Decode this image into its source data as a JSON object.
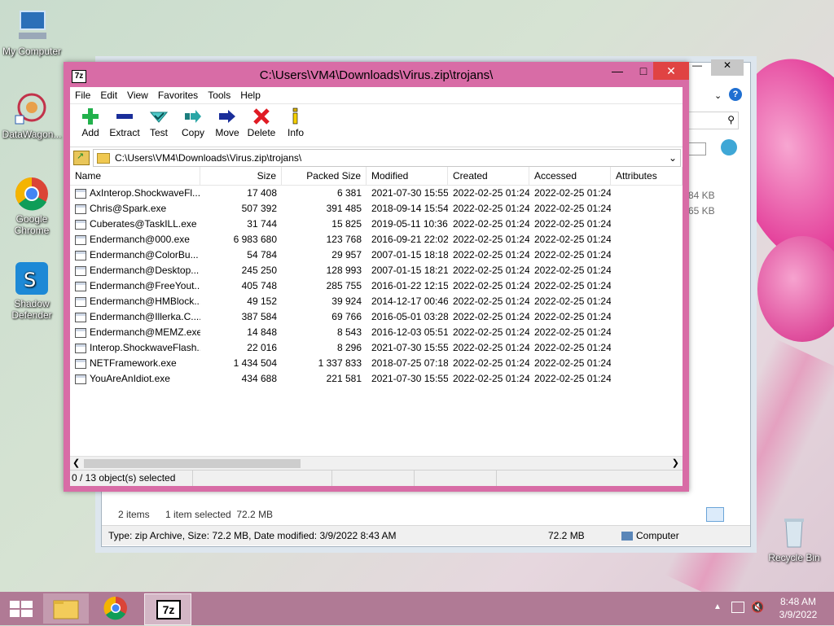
{
  "desktop": {
    "icons": [
      {
        "label": "My Computer"
      },
      {
        "label": "DataWagon..."
      },
      {
        "label": "Google Chrome"
      },
      {
        "label": "Shadow Defender"
      },
      {
        "label": "Recycle Bin"
      }
    ]
  },
  "explorer": {
    "size_col_values": [
      "84 KB",
      "65 KB"
    ],
    "items_count": "2 items",
    "selected": "1 item selected  72.2 MB",
    "status_type": "Type: zip Archive, Size: 72.2 MB, Date modified: 3/9/2022 8:43 AM",
    "status_size": "72.2 MB",
    "status_location": "Computer"
  },
  "window": {
    "title": "C:\\Users\\VM4\\Downloads\\Virus.zip\\trojans\\",
    "app_icon_label": "7z",
    "menu": [
      "File",
      "Edit",
      "View",
      "Favorites",
      "Tools",
      "Help"
    ],
    "toolbar": [
      "Add",
      "Extract",
      "Test",
      "Copy",
      "Move",
      "Delete",
      "Info"
    ],
    "address": "C:\\Users\\VM4\\Downloads\\Virus.zip\\trojans\\",
    "columns": [
      "Name",
      "Size",
      "Packed Size",
      "Modified",
      "Created",
      "Accessed",
      "Attributes"
    ],
    "files": [
      {
        "name": "AxInterop.ShockwaveFl...",
        "size": "17 408",
        "packed": "6 381",
        "modified": "2021-07-30 15:55",
        "created": "2022-02-25 01:24",
        "accessed": "2022-02-25 01:24"
      },
      {
        "name": "Chris@Spark.exe",
        "size": "507 392",
        "packed": "391 485",
        "modified": "2018-09-14 15:54",
        "created": "2022-02-25 01:24",
        "accessed": "2022-02-25 01:24"
      },
      {
        "name": "Cuberates@TaskILL.exe",
        "size": "31 744",
        "packed": "15 825",
        "modified": "2019-05-11 10:36",
        "created": "2022-02-25 01:24",
        "accessed": "2022-02-25 01:24"
      },
      {
        "name": "Endermanch@000.exe",
        "size": "6 983 680",
        "packed": "123 768",
        "modified": "2016-09-21 22:02",
        "created": "2022-02-25 01:24",
        "accessed": "2022-02-25 01:24"
      },
      {
        "name": "Endermanch@ColorBu...",
        "size": "54 784",
        "packed": "29 957",
        "modified": "2007-01-15 18:18",
        "created": "2022-02-25 01:24",
        "accessed": "2022-02-25 01:24"
      },
      {
        "name": "Endermanch@Desktop...",
        "size": "245 250",
        "packed": "128 993",
        "modified": "2007-01-15 18:21",
        "created": "2022-02-25 01:24",
        "accessed": "2022-02-25 01:24"
      },
      {
        "name": "Endermanch@FreeYout...",
        "size": "405 748",
        "packed": "285 755",
        "modified": "2016-01-22 12:15",
        "created": "2022-02-25 01:24",
        "accessed": "2022-02-25 01:24"
      },
      {
        "name": "Endermanch@HMBlock...",
        "size": "49 152",
        "packed": "39 924",
        "modified": "2014-12-17 00:46",
        "created": "2022-02-25 01:24",
        "accessed": "2022-02-25 01:24"
      },
      {
        "name": "Endermanch@Illerka.C....",
        "size": "387 584",
        "packed": "69 766",
        "modified": "2016-05-01 03:28",
        "created": "2022-02-25 01:24",
        "accessed": "2022-02-25 01:24"
      },
      {
        "name": "Endermanch@MEMZ.exe",
        "size": "14 848",
        "packed": "8 543",
        "modified": "2016-12-03 05:51",
        "created": "2022-02-25 01:24",
        "accessed": "2022-02-25 01:24"
      },
      {
        "name": "Interop.ShockwaveFlash...",
        "size": "22 016",
        "packed": "8 296",
        "modified": "2021-07-30 15:55",
        "created": "2022-02-25 01:24",
        "accessed": "2022-02-25 01:24"
      },
      {
        "name": "NETFramework.exe",
        "size": "1 434 504",
        "packed": "1 337 833",
        "modified": "2018-07-25 07:18",
        "created": "2022-02-25 01:24",
        "accessed": "2022-02-25 01:24"
      },
      {
        "name": "YouAreAnIdiot.exe",
        "size": "434 688",
        "packed": "221 581",
        "modified": "2021-07-30 15:55",
        "created": "2022-02-25 01:24",
        "accessed": "2022-02-25 01:24"
      }
    ],
    "status": "0 / 13 object(s) selected"
  },
  "taskbar": {
    "app_7z_label": "7z",
    "time": "8:48 AM",
    "date": "3/9/2022"
  },
  "colors": {
    "window_frame": "#d86ca6",
    "taskbar": "#b07a95",
    "add_icon": "#22b14c",
    "delete_icon": "#e01b24"
  }
}
